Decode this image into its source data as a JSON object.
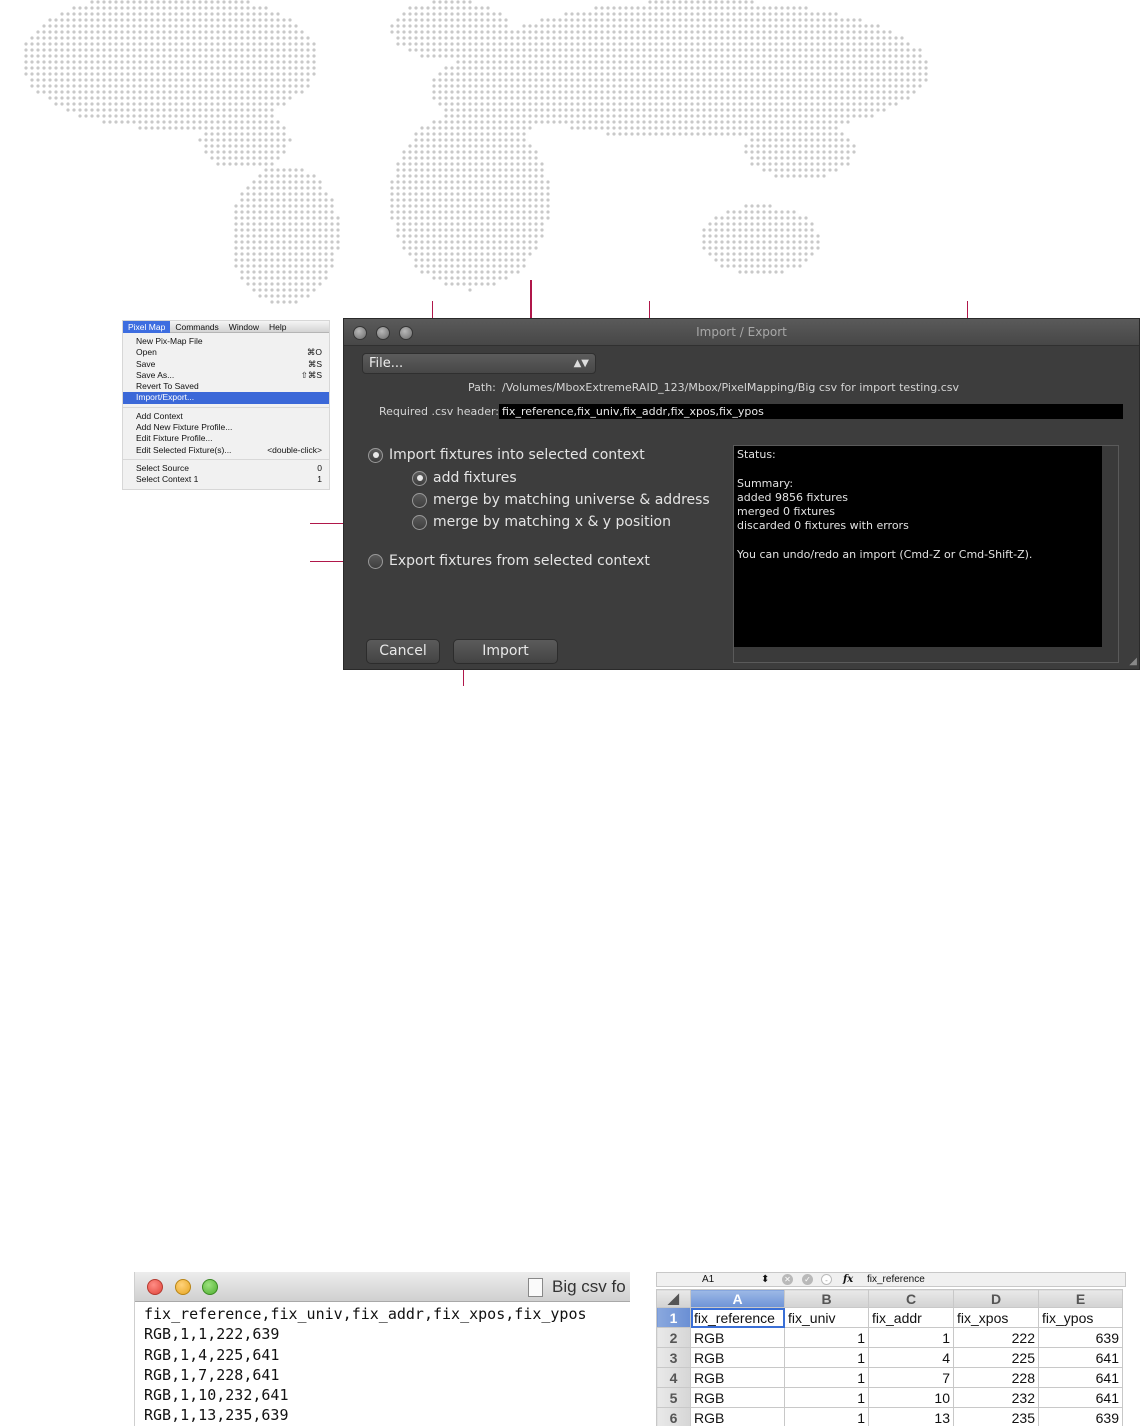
{
  "menu": {
    "bar": [
      "Pixel Map",
      "Commands",
      "Window",
      "Help"
    ],
    "items": [
      {
        "label": "New Pix-Map File",
        "shortcut": ""
      },
      {
        "label": "Open",
        "shortcut": "⌘O"
      },
      {
        "label": "Save",
        "shortcut": "⌘S"
      },
      {
        "label": "Save As...",
        "shortcut": "⇧⌘S"
      },
      {
        "label": "Revert To Saved",
        "shortcut": ""
      },
      {
        "label": "Import/Export...",
        "shortcut": ""
      },
      {
        "label": "Add Context",
        "shortcut": ""
      },
      {
        "label": "Add New Fixture Profile...",
        "shortcut": ""
      },
      {
        "label": "Edit Fixture Profile...",
        "shortcut": ""
      },
      {
        "label": "Edit Selected Fixture(s)...",
        "shortcut": "<double-click>"
      },
      {
        "label": "Select Source",
        "shortcut": "0"
      },
      {
        "label": "Select Context 1",
        "shortcut": "1"
      }
    ]
  },
  "dialog": {
    "title": "Import / Export",
    "file_popup": "File...",
    "path_label": "Path:",
    "path_value": "/Volumes/MboxExtremeRAID_123/Mbox/PixelMapping/Big csv for import testing.csv",
    "header_label": "Required .csv header:",
    "header_value": "fix_reference,fix_univ,fix_addr,fix_xpos,fix_ypos",
    "import_option": "Import fixtures into selected context",
    "sub_add": "add fixtures",
    "sub_merge_univ": "merge by matching universe & address",
    "sub_merge_xy": "merge by matching x & y position",
    "export_option": "Export fixtures from selected context",
    "status_text": "Status:\n\nSummary:\nadded 9856 fixtures\nmerged 0 fixtures\ndiscarded 0 fixtures with errors\n\nYou can undo/redo an import (Cmd-Z or Cmd-Shift-Z).",
    "cancel_label": "Cancel",
    "import_label": "Import"
  },
  "text_editor": {
    "filename": "Big csv fo",
    "lines": [
      "fix_reference,fix_univ,fix_addr,fix_xpos,fix_ypos",
      "RGB,1,1,222,639",
      "RGB,1,4,225,641",
      "RGB,1,7,228,641",
      "RGB,1,10,232,641",
      "RGB,1,13,235,639"
    ]
  },
  "spreadsheet": {
    "cell_ref": "A1",
    "fx_label": "fx",
    "formula_value": "fix_reference",
    "columns": [
      "A",
      "B",
      "C",
      "D",
      "E"
    ],
    "rows": [
      [
        "1",
        "fix_reference",
        "fix_univ",
        "fix_addr",
        "fix_xpos",
        "fix_ypos"
      ],
      [
        "2",
        "RGB",
        "1",
        "1",
        "222",
        "639"
      ],
      [
        "3",
        "RGB",
        "1",
        "4",
        "225",
        "641"
      ],
      [
        "4",
        "RGB",
        "1",
        "7",
        "228",
        "641"
      ],
      [
        "5",
        "RGB",
        "1",
        "10",
        "232",
        "641"
      ],
      [
        "6",
        "RGB",
        "1",
        "13",
        "235",
        "639"
      ]
    ]
  }
}
